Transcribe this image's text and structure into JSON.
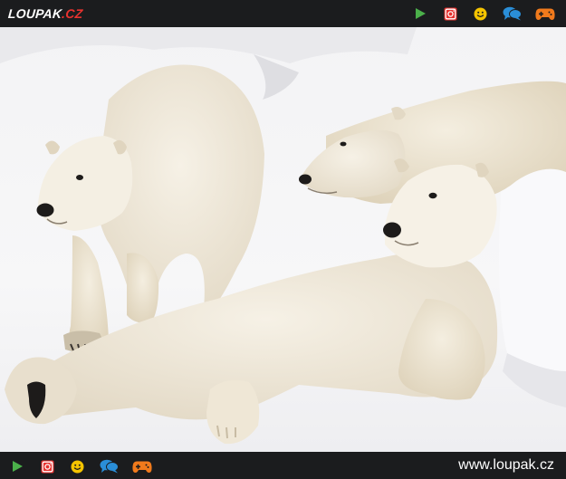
{
  "header": {
    "logo_main": "LOUPAK",
    "logo_suffix": ".CZ",
    "icons": [
      "play-icon",
      "instagram-icon",
      "smiley-icon",
      "chat-bubbles-icon",
      "gamepad-icon"
    ]
  },
  "photo": {
    "subject": "polar-bears-photo"
  },
  "footer": {
    "icons": [
      "play-icon",
      "instagram-icon",
      "smiley-icon",
      "chat-bubbles-icon",
      "gamepad-icon"
    ],
    "site_url": "www.loupak.cz"
  },
  "colors": {
    "bar_background": "#1b1c1e",
    "play": "#4bb04a",
    "instagram": "#e8322f",
    "smiley": "#f5c400",
    "chat": "#2a8ed8",
    "gamepad": "#f07a1c"
  }
}
